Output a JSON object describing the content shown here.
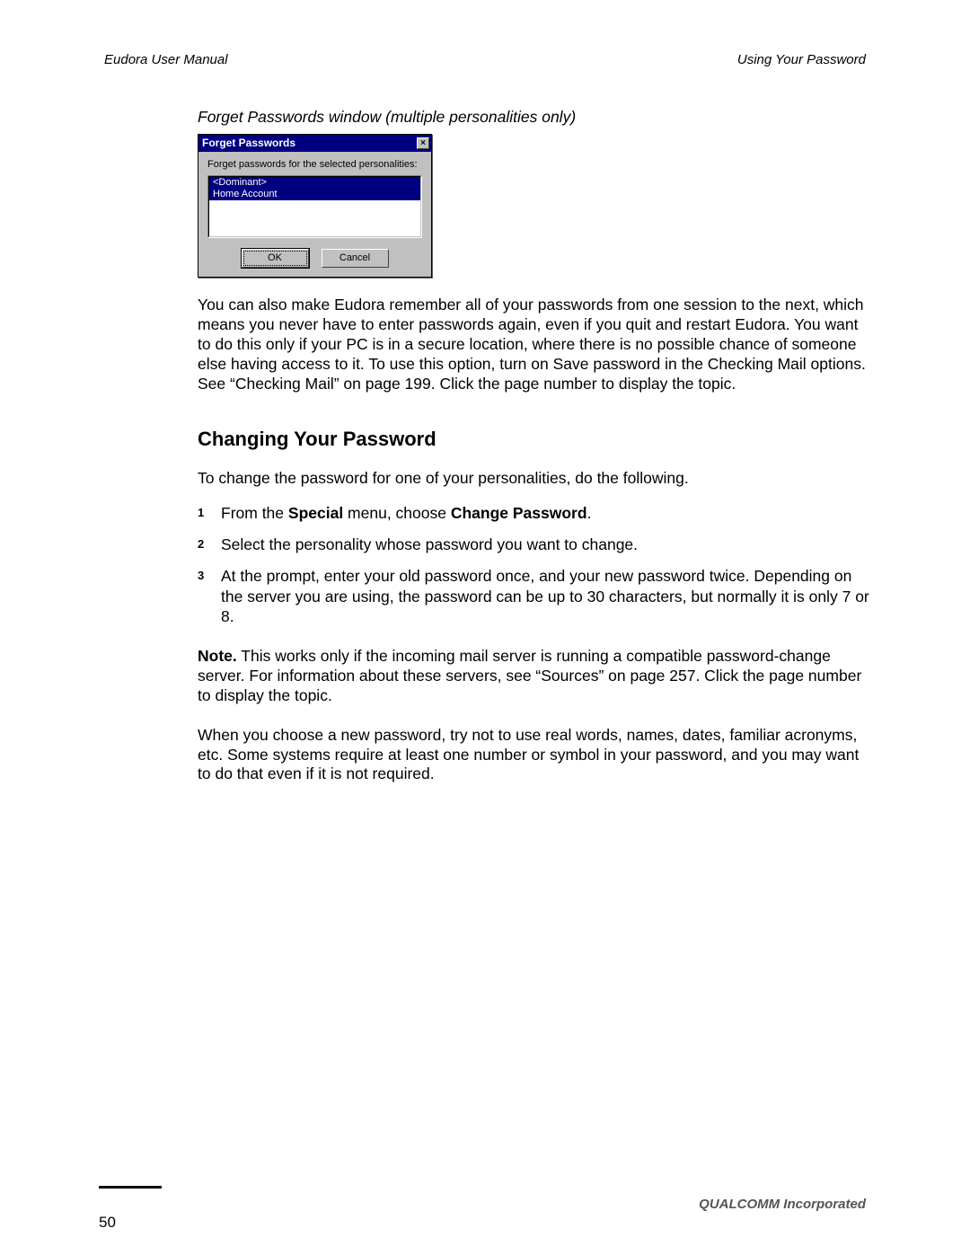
{
  "header": {
    "left": "Eudora User Manual",
    "right": "Using Your Password"
  },
  "caption": "Forget Passwords window (multiple personalities only)",
  "dialog": {
    "title": "Forget Passwords",
    "close_glyph": "×",
    "instruction": "Forget passwords for the selected personalities:",
    "items": [
      "<Dominant>",
      "Home Account"
    ],
    "ok": "OK",
    "cancel": "Cancel"
  },
  "para1": "You can also make Eudora remember all of your passwords from one session to the next, which means you never have to enter passwords again, even if you quit and restart Eudora. You want to do this only if your PC is in a secure location, where there is no possible chance of someone else having access to it. To use this option, turn on Save password in the Checking Mail options. See “Checking Mail” on page 199. Click the page number to display the topic.",
  "heading": "Changing Your Password",
  "para2": "To change the password for one of your personalities, do the following.",
  "steps": {
    "n1": "1",
    "s1_pre": "From the ",
    "s1_b1": "Special",
    "s1_mid": " menu, choose ",
    "s1_b2": "Change Password",
    "s1_post": ".",
    "n2": "2",
    "s2": "Select the personality whose password you want to change.",
    "n3": "3",
    "s3": "At the prompt, enter your old password once, and your new password twice. Depending on the server you are using, the password can be up to 30 characters, but normally it is only 7 or 8."
  },
  "note_b": "Note.",
  "note_rest": " This works only if the incoming mail server is running a compatible pass­word-change server. For information about these servers, see “Sources” on page 257. Click the page number to display the topic.",
  "para3": "When you choose a new password, try not to use real words, names, dates, familiar acro­nyms, etc. Some systems require at least one number or symbol in your password, and you may want to do that even if it is not required.",
  "footer": {
    "company": "QUALCOMM Incorporated",
    "page": "50"
  }
}
